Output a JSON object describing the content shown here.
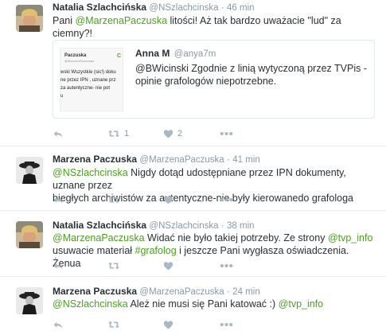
{
  "tweets": [
    {
      "name": "Natalia Szlachcińska",
      "handle": "@NSzlachcinska",
      "dot": "·",
      "time": "46 min",
      "text_parts": {
        "pre": "Pani ",
        "mention": "@MarzenaPaczuska",
        "post": " litości! Aż tak bardzo uważacie \"lud\" za ciemny?!"
      },
      "quote": {
        "name": "Anna M",
        "handle": "@anya7m",
        "text": "@BWicinski Zgodnie z linią wytyczoną przez TVPis - opinie grafologów niepotrzebne.",
        "thumb": {
          "title": "Paczuska",
          "subtitle": "@MarzenaPaczuska",
          "line1": "wski Wszystkie (sic!) doku",
          "line2": "ne przez IPN , uznane prz",
          "line3": "za autentyczne- nie pot",
          "line4": "u",
          "side": "C"
        }
      },
      "retweet_count": "1",
      "like_count": "2"
    },
    {
      "name": "Marzena Paczuska",
      "handle": "@MarzenaPaczuska",
      "dot": "·",
      "time": "41 min",
      "text_parts": {
        "mention": "@NSzlachcinska",
        "line1": " Nigdy dotąd udostępniane przez IPN dokumenty, uznane przez",
        "line2": "biegłych archiwistów za autentyczne-nie były kierowanedo grafologa"
      }
    },
    {
      "name": "Natalia Szlachcińska",
      "handle": "@NSzlachcinska",
      "dot": "·",
      "time": "38 min",
      "text_parts": {
        "mention": "@MarzenaPaczuska",
        "mid1": " Widać nie było takiej potrzeby. Ze strony ",
        "link1": "@tvp_info",
        "line2a": "usuwacie materiał ",
        "hashtag": "#grafolog",
        "line2b": " i jeszcze Pani wygłasza oświadczenia. Żenua"
      }
    },
    {
      "name": "Marzena Paczuska",
      "handle": "@MarzenaPaczuska",
      "dot": "·",
      "time": "24 min",
      "text_parts": {
        "mention": "@NSzlachcinska",
        "mid": " Ależ nie musi się Pani katować :) ",
        "link": "@tvp_info"
      }
    }
  ],
  "icons": {
    "reply": "reply-icon",
    "retweet": "retweet-icon",
    "like": "heart-icon",
    "more": "more-icon"
  },
  "colors": {
    "link": "#4aa020",
    "muted": "#8899a6",
    "icon": "#aab8c2",
    "border": "#e6ecf0"
  }
}
